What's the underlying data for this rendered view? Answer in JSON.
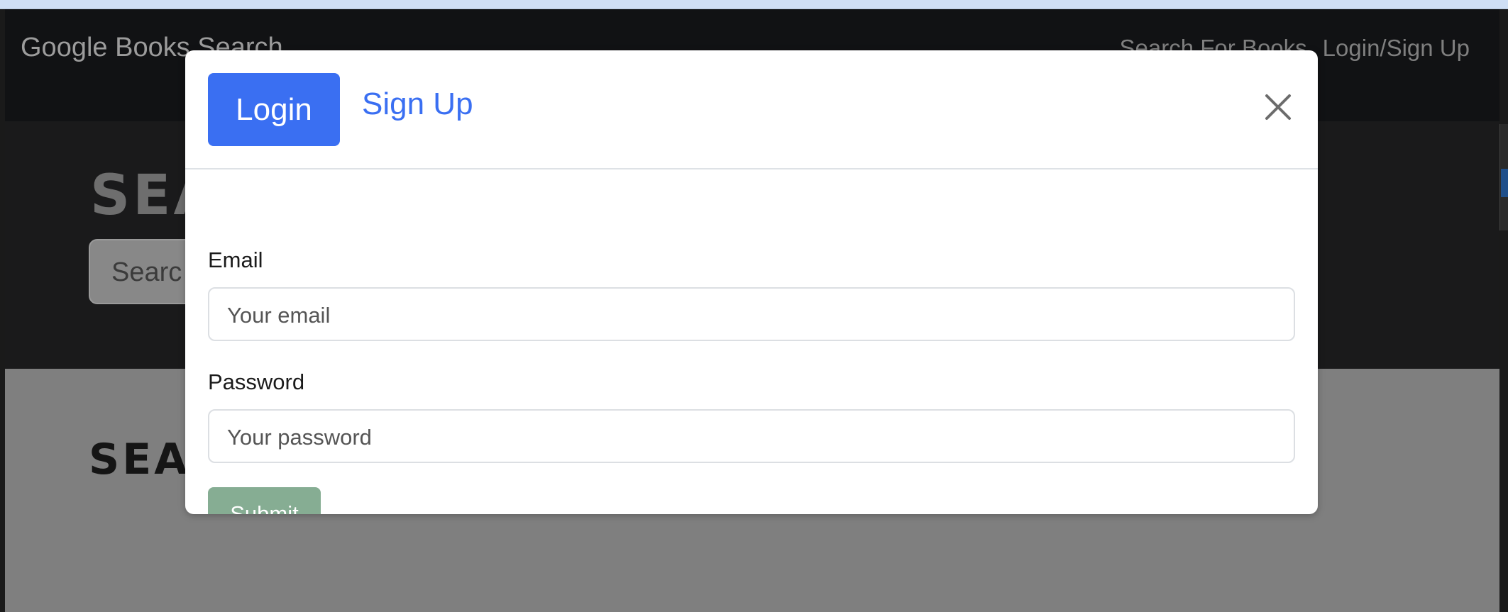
{
  "page": {
    "brand": "Google Books Search",
    "nav": {
      "search_link": "Search For Books",
      "login_link": "Login/Sign Up"
    },
    "hero_title": "SEA",
    "hero_search_placeholder": "Searc",
    "results_title": "SEA"
  },
  "modal": {
    "tabs": {
      "login": "Login",
      "signup": "Sign Up"
    },
    "close_icon": "close-icon",
    "form": {
      "email_label": "Email",
      "email_placeholder": "Your email",
      "password_label": "Password",
      "password_placeholder": "Your password",
      "submit_label": "Submit"
    }
  },
  "colors": {
    "primary": "#3a6ff2",
    "submit_disabled": "#86ad93",
    "navbar": "#111214"
  }
}
